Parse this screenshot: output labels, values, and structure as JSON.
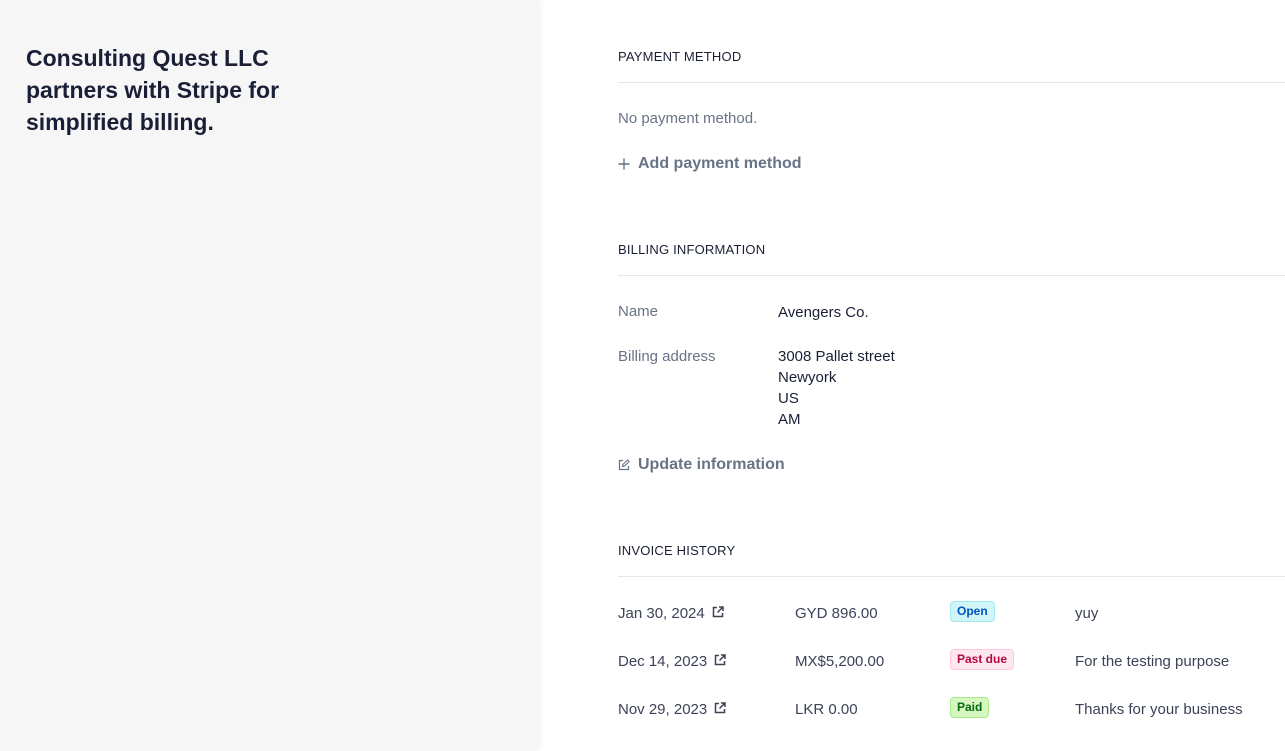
{
  "merchant": {
    "statement": "Consulting Quest LLC partners with Stripe for simplified billing."
  },
  "payment_method": {
    "title": "PAYMENT METHOD",
    "empty_text": "No payment method.",
    "add_label": "Add payment method",
    "add_icon": "plus-icon"
  },
  "billing_info": {
    "title": "BILLING INFORMATION",
    "name_label": "Name",
    "name_value": "Avengers Co.",
    "address_label": "Billing address",
    "address_lines": [
      "3008 Pallet street",
      "Newyork",
      "US",
      "AM"
    ],
    "update_label": "Update information",
    "update_icon": "edit-icon"
  },
  "invoice_history": {
    "title": "INVOICE HISTORY",
    "rows": [
      {
        "date": "Jan 30, 2024",
        "amount": "GYD 896.00",
        "status": "Open",
        "status_kind": "open",
        "memo": "yuy"
      },
      {
        "date": "Dec 14, 2023",
        "amount": "MX$5,200.00",
        "status": "Past due",
        "status_kind": "pastdue",
        "memo": "For the testing purpose"
      },
      {
        "date": "Nov 29, 2023",
        "amount": "LKR 0.00",
        "status": "Paid",
        "status_kind": "paid",
        "memo": "Thanks for your business"
      }
    ]
  },
  "colors": {
    "left_panel_bg": "#f6f6f7",
    "muted_text": "#697386",
    "open_badge": "#cff5f6",
    "past_due_badge": "#ffe7f2",
    "paid_badge": "#d7f7c2"
  }
}
